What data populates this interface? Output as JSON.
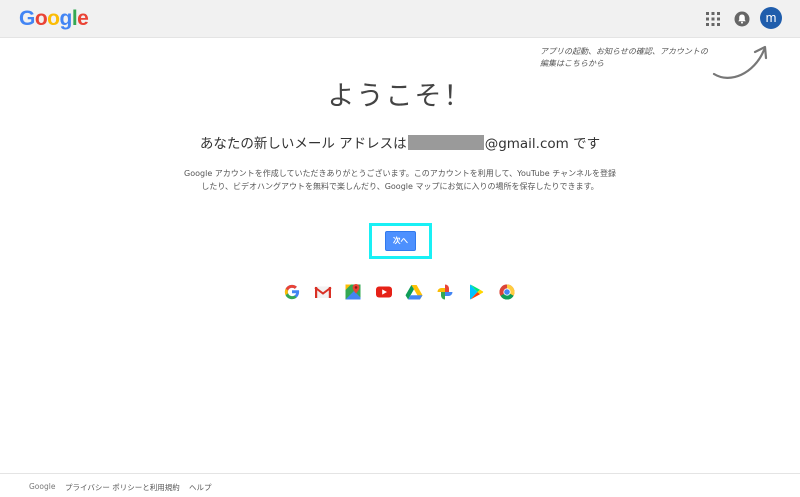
{
  "header": {
    "logo_letters": [
      {
        "char": "G",
        "color": "#4285F4"
      },
      {
        "char": "o",
        "color": "#EA4335"
      },
      {
        "char": "o",
        "color": "#FBBC05"
      },
      {
        "char": "g",
        "color": "#4285F4"
      },
      {
        "char": "l",
        "color": "#34A853"
      },
      {
        "char": "e",
        "color": "#EA4335"
      }
    ],
    "apps_icon": "apps-grid-icon",
    "notifications_icon": "notifications-icon",
    "avatar_initial": "m",
    "avatar_color": "#1f5dac"
  },
  "hint": {
    "text": "アプリの起動、お知らせの確認、アカウントの編集はこちらから"
  },
  "main": {
    "title": "ようこそ！",
    "address_prefix": "あなたの新しいメール アドレスは",
    "address_domain": "@gmail.com",
    "address_suffix": " です",
    "description": "Google アカウントを作成していただきありがとうございます。このアカウントを利用して、YouTube チャンネルを登録したり、ビデオハングアウトを無料で楽しんだり、Google マップにお気に入りの場所を保存したりできます。",
    "next_label": "次へ",
    "highlight_color": "#19f0f5",
    "button_color": "#4d90fe"
  },
  "products": [
    {
      "name": "Google",
      "icon": "google-g-icon"
    },
    {
      "name": "Gmail",
      "icon": "gmail-icon"
    },
    {
      "name": "Maps",
      "icon": "maps-icon"
    },
    {
      "name": "YouTube",
      "icon": "youtube-icon"
    },
    {
      "name": "Drive",
      "icon": "drive-icon"
    },
    {
      "name": "Photos",
      "icon": "photos-icon"
    },
    {
      "name": "Play",
      "icon": "play-icon"
    },
    {
      "name": "Chrome",
      "icon": "chrome-icon"
    }
  ],
  "footer": {
    "logo": "Google",
    "privacy_terms": "プライバシー ポリシーと利用規約",
    "help": "ヘルプ"
  }
}
